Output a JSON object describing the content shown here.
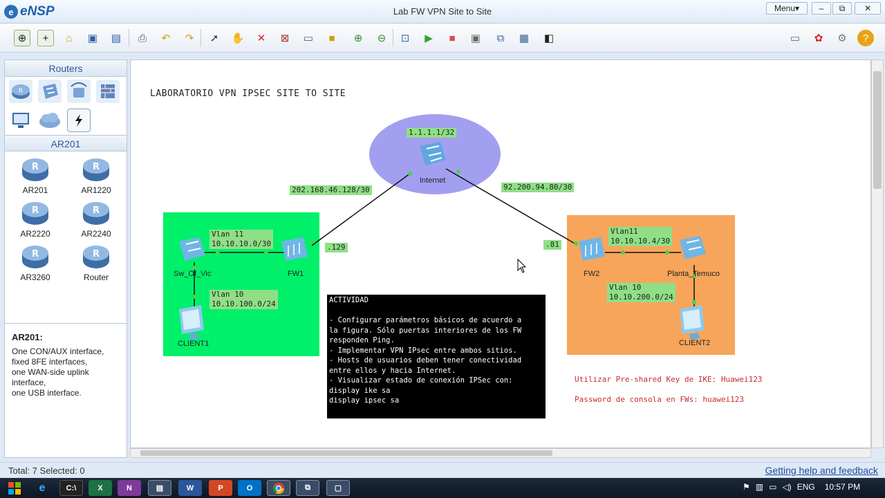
{
  "window": {
    "app_name": "eNSP",
    "title": "Lab FW VPN Site to Site",
    "menu_label": "Menu▾",
    "min": "–",
    "restore": "⧉",
    "close": "✕"
  },
  "toolbar": {
    "left": [
      "new-topology-icon",
      "new-file-icon",
      "open-icon",
      "save-icon",
      "save-as-icon",
      "print-icon",
      "undo-icon",
      "redo-icon",
      "pointer-icon",
      "pan-icon",
      "delete-icon",
      "clear-icon",
      "text-icon",
      "rectangle-icon",
      "zoom-in-icon",
      "zoom-out-icon",
      "fit-icon",
      "start-icon",
      "stop-icon",
      "capture-icon",
      "topology-icon",
      "grid-icon",
      "console-icon"
    ],
    "right": [
      "chat-icon",
      "huawei-icon",
      "settings-icon",
      "help-icon"
    ]
  },
  "left_panel": {
    "category_title": "Routers",
    "category_icons": [
      "router-icon",
      "switch-icon",
      "wireless-icon",
      "firewall-icon",
      "pc-icon",
      "cloud-icon",
      "link-icon"
    ],
    "device_title": "AR201",
    "devices": [
      "AR201",
      "AR1220",
      "AR2220",
      "AR2240",
      "AR3260",
      "Router"
    ],
    "desc_title": "AR201:",
    "desc_text": "One CON/AUX interface,\nfixed 8FE interfaces,\none WAN-side uplink\ninterface,\none USB interface."
  },
  "topology": {
    "heading": "LABORATORIO VPN IPSEC SITE TO SITE",
    "internet": {
      "label": "Internet",
      "address": "1.1.1.1/32"
    },
    "left_link": "202.168.46.128/30",
    "right_link": "92.200.94.80/30",
    "left_site": {
      "switch": "Sw_Of_Vic",
      "firewall": "FW1",
      "client": "CLIENT1",
      "vlan11": "Vlan 11\n10.10.10.0/30",
      "vlan10": "Vlan 10\n10.10.100.0/24",
      "fw_ip": ".129"
    },
    "right_site": {
      "switch": "Planta_Temuco",
      "firewall": "FW2",
      "client": "CLIENT2",
      "vlan11": "Vlan11\n10.10.10.4/30",
      "vlan10": "Vlan 10\n10.10.200.0/24",
      "fw_ip": ".81"
    },
    "activity": "ACTIVIDAD\n\n- Configurar parámetros básicos de acuerdo a\nla figura. Sólo puertas interiores de los FW\nresponden Ping.\n- Implementar VPN IPsec entre ambos sitios.\n- Hosts de usuarios deben tener conectividad\nentre ellos y hacia Internet.\n- Visualizar estado de conexión IPSec con:\ndisplay ike sa\ndisplay ipsec sa",
    "note1": "Utilizar Pre-shared Key de IKE: Huawei123",
    "note2": "Password de consola en FWs: huawei123",
    "colors": {
      "left_site": "#00f06a",
      "right_site": "#f7a55a",
      "internet_cloud": "#a29ff0",
      "label_bg": "#8fdf86",
      "note": "#c92b2b"
    }
  },
  "status": {
    "left": "Total: 7  Selected: 0",
    "right": "Getting help and feedback"
  },
  "taskbar": {
    "items": [
      "windows-start-icon",
      "ie-icon",
      "cmd-icon",
      "excel-icon",
      "onenote-icon",
      "explorer-icon",
      "word-icon",
      "powerpoint-icon",
      "outlook-icon",
      "chrome-icon",
      "ensp-icon",
      "window-icon"
    ],
    "lang": "ENG",
    "time": "10:57 PM"
  }
}
